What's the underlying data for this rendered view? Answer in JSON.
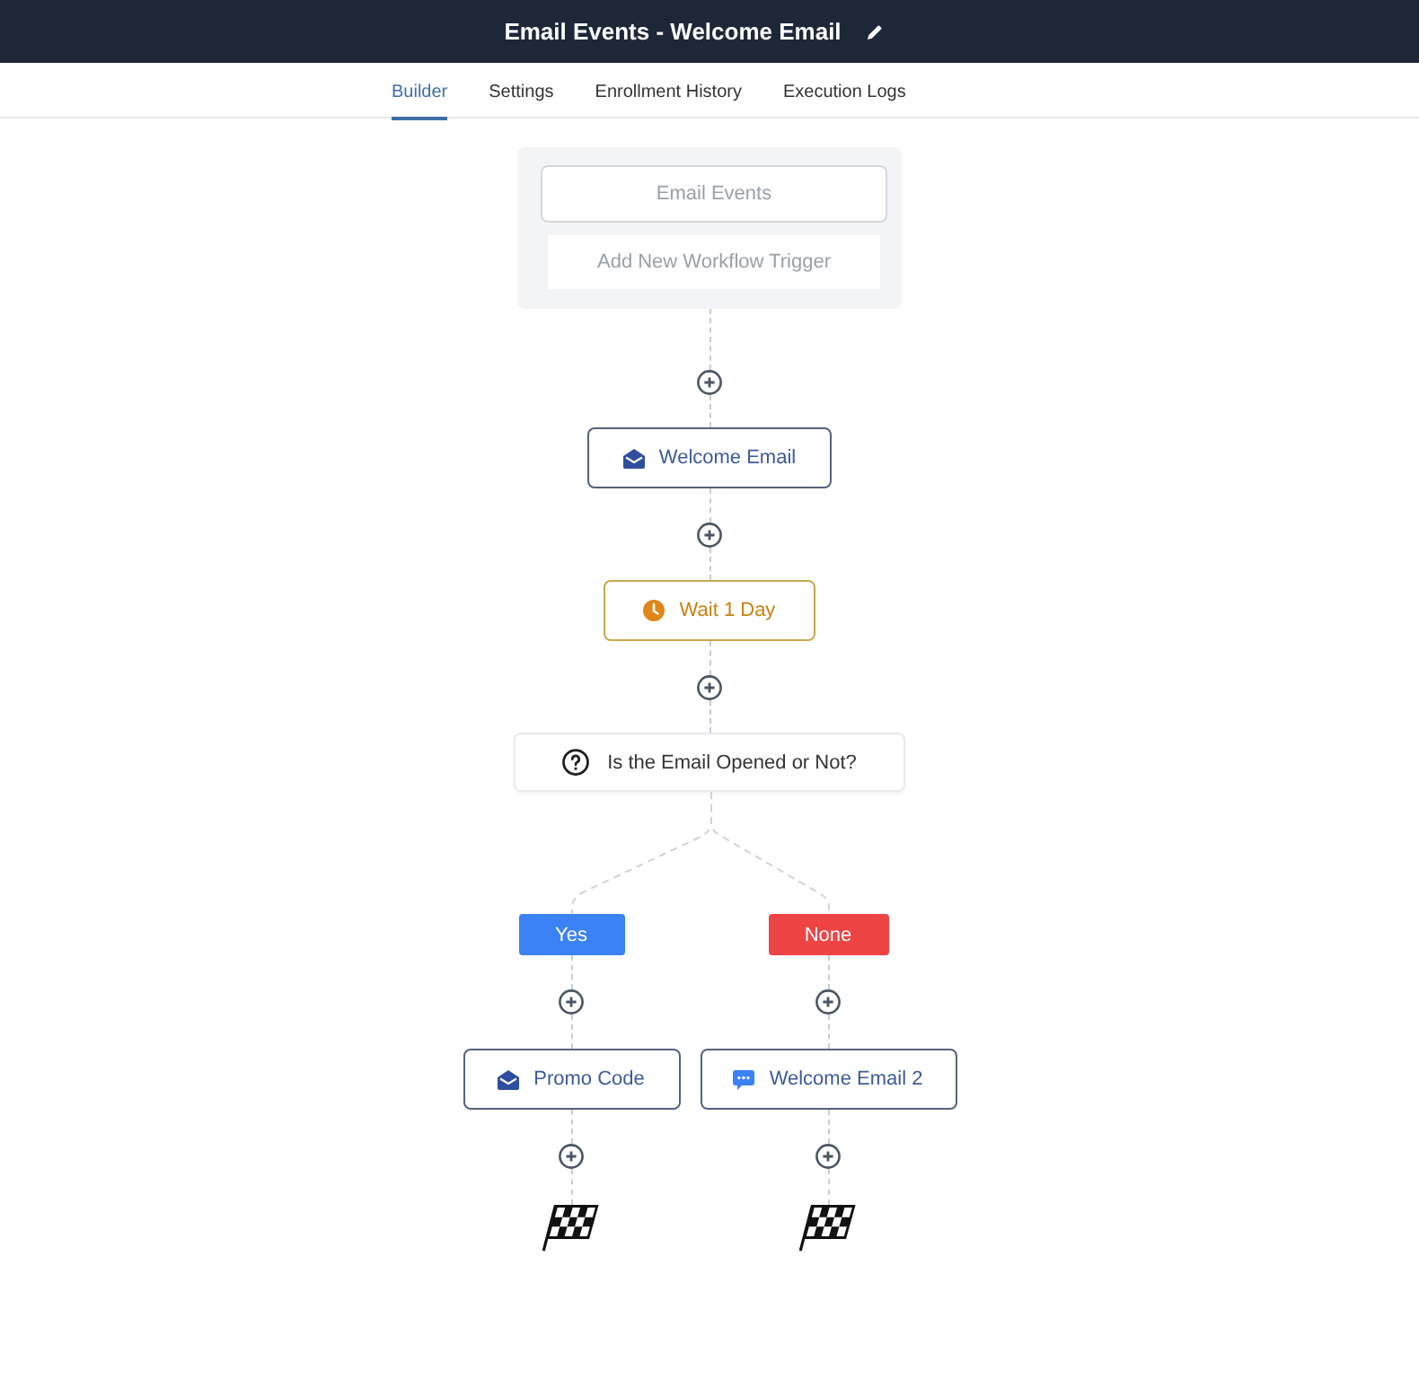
{
  "header": {
    "title": "Email Events - Welcome Email"
  },
  "tabs": [
    {
      "label": "Builder",
      "selected": true
    },
    {
      "label": "Settings",
      "selected": false
    },
    {
      "label": "Enrollment History",
      "selected": false
    },
    {
      "label": "Execution Logs",
      "selected": false
    }
  ],
  "trigger": {
    "event": "Email Events",
    "add_button": "Add New Workflow Trigger"
  },
  "steps": [
    {
      "kind": "email",
      "label": "Welcome Email"
    },
    {
      "kind": "wait",
      "label": "Wait 1 Day"
    },
    {
      "kind": "condition",
      "label": "Is the Email Opened or Not?"
    }
  ],
  "branches": [
    {
      "label": "Yes",
      "color": "#3b82f6",
      "steps": [
        {
          "kind": "email",
          "label": "Promo Code"
        }
      ]
    },
    {
      "label": "None",
      "color": "#ef4444",
      "steps": [
        {
          "kind": "message",
          "label": "Welcome Email 2"
        }
      ]
    }
  ]
}
